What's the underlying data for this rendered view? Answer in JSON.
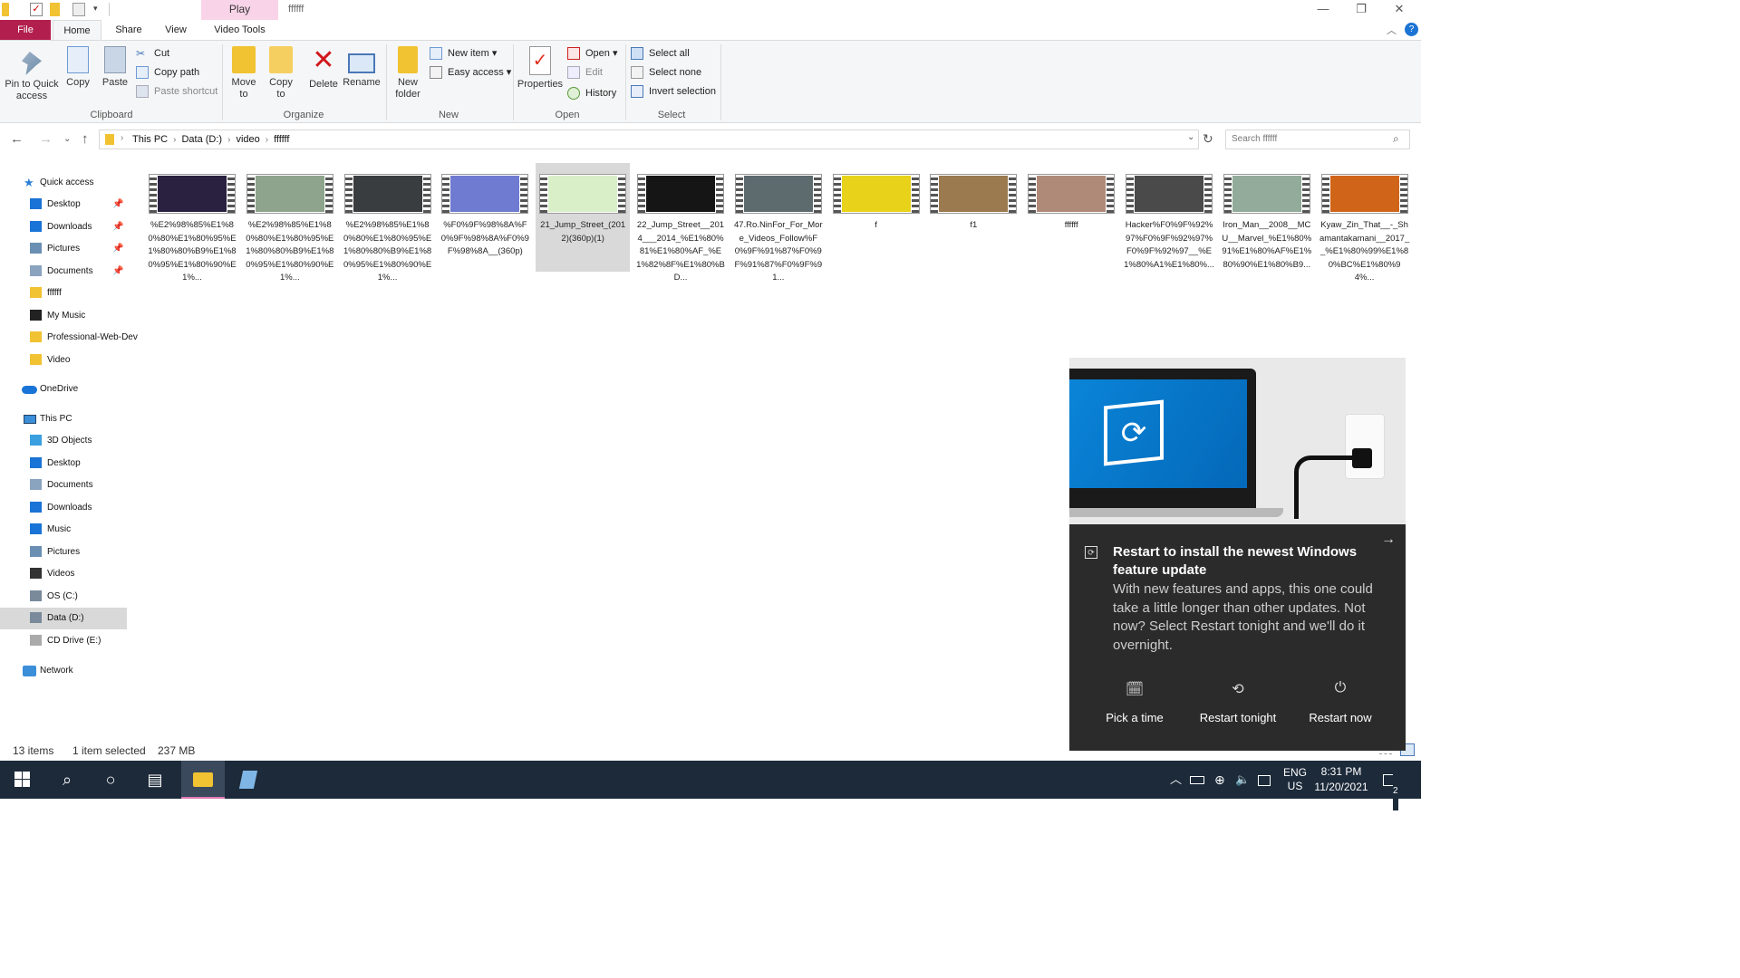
{
  "window": {
    "title": "ffffff",
    "context_tab": "Play",
    "controls": {
      "minimize": "—",
      "maximize": "❐",
      "close": "✕"
    }
  },
  "tabs": {
    "file": "File",
    "home": "Home",
    "share": "Share",
    "view": "View",
    "video_tools": "Video Tools"
  },
  "ribbon": {
    "clipboard": {
      "pin": "Pin to Quick access",
      "copy": "Copy",
      "paste": "Paste",
      "cut": "Cut",
      "copy_path": "Copy path",
      "paste_shortcut": "Paste shortcut",
      "label": "Clipboard"
    },
    "organize": {
      "move_to": "Move to",
      "copy_to": "Copy to",
      "delete": "Delete",
      "rename": "Rename",
      "label": "Organize"
    },
    "new": {
      "new_folder": "New folder",
      "new_item": "New item",
      "easy_access": "Easy access",
      "label": "New"
    },
    "open": {
      "properties": "Properties",
      "open": "Open",
      "edit": "Edit",
      "history": "History",
      "label": "Open"
    },
    "select": {
      "select_all": "Select all",
      "select_none": "Select none",
      "invert": "Invert selection",
      "label": "Select"
    }
  },
  "address": {
    "crumbs": [
      "This PC",
      "Data (D:)",
      "video",
      "ffffff"
    ],
    "search_placeholder": "Search ffffff"
  },
  "nav": {
    "quick_access": "Quick access",
    "items": [
      "Desktop",
      "Downloads",
      "Pictures",
      "Documents",
      "ffffff",
      "My Music",
      "Professional-Web-Dev",
      "Video"
    ],
    "onedrive": "OneDrive",
    "this_pc": "This PC",
    "pc_items": [
      "3D Objects",
      "Desktop",
      "Documents",
      "Downloads",
      "Music",
      "Pictures",
      "Videos",
      "OS (C:)",
      "Data (D:)",
      "CD Drive (E:)"
    ],
    "network": "Network"
  },
  "files": [
    {
      "name": "%E2%98%85%E1%80%80%E1%80%95%E1%80%80%B9%E1%80%95%E1%80%90%E1%...",
      "color": "#2a2140"
    },
    {
      "name": "%E2%98%85%E1%80%80%E1%80%95%E1%80%80%B9%E1%80%95%E1%80%90%E1%...",
      "color": "#8fa48c"
    },
    {
      "name": "%E2%98%85%E1%80%80%E1%80%95%E1%80%80%B9%E1%80%95%E1%80%90%E1%...",
      "color": "#3a3d3f"
    },
    {
      "name": "%F0%9F%98%8A%F0%9F%98%8A%F0%9F%98%8A__(360p)",
      "color": "#6f7bd0"
    },
    {
      "name": "21_Jump_Street_(2012)(360p)(1)",
      "color": "#d8efc8"
    },
    {
      "name": "22_Jump_Street__2014___2014_%E1%80%81%E1%80%AF_%E1%82%8F%E1%80%BD...",
      "color": "#151515"
    },
    {
      "name": "47.Ro.NinFor_For_More_Videos_Follow%F0%9F%91%87%F0%9F%91%87%F0%9F%91...",
      "color": "#5d6a6e"
    },
    {
      "name": "f",
      "color": "#e8d21a"
    },
    {
      "name": "f1",
      "color": "#9a7a4e"
    },
    {
      "name": "ffffff",
      "color": "#b08a78"
    },
    {
      "name": "Hacker%F0%9F%92%97%F0%9F%92%97%F0%9F%92%97__%E1%80%A1%E1%80%...",
      "color": "#4a4a4a"
    },
    {
      "name": "Iron_Man__2008__MCU__Marvel_%E1%80%91%E1%80%AF%E1%80%90%E1%80%B9...",
      "color": "#93ab9a"
    },
    {
      "name": "Kyaw_Zin_That__-_Shamantakamani__2017__%E1%80%99%E1%80%BC%E1%80%94%...",
      "color": "#d0651a"
    }
  ],
  "status": {
    "count": "13 items",
    "selected": "1 item selected",
    "size": "237 MB"
  },
  "toast": {
    "title": "Restart to install the newest Windows feature update",
    "body": "With new features and apps, this one could take a little longer than other updates. Not now? Select Restart tonight and we'll do it overnight.",
    "buttons": {
      "pick": "Pick a time",
      "tonight": "Restart tonight",
      "now": "Restart now"
    }
  },
  "taskbar": {
    "lang1": "ENG",
    "lang2": "US",
    "time": "8:31 PM",
    "date": "11/20/2021",
    "notif_count": "2"
  },
  "colors": {
    "file_tab": "#b21f4f",
    "play_tab": "#f9d4e8",
    "taskbar": "#1c2a3a",
    "toast": "#2b2b2b",
    "selection": "#d9d9d9"
  }
}
